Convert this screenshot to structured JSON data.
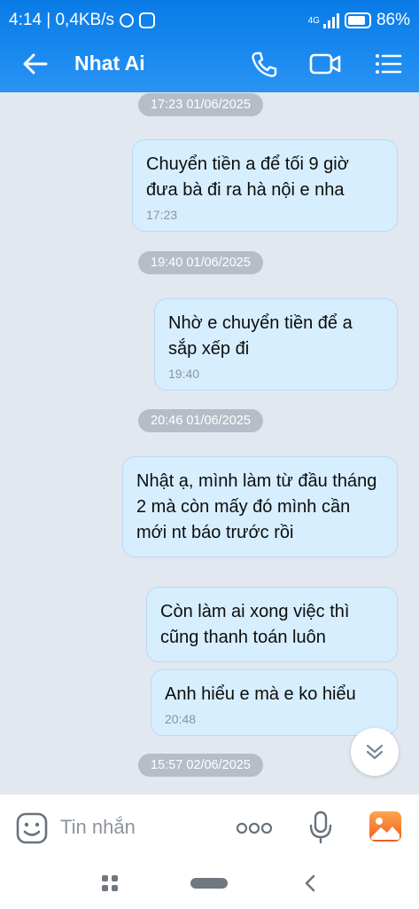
{
  "status_bar": {
    "time": "4:14 | 0,4KB/s",
    "network": "4G",
    "battery": "86%",
    "battery_level": 0.86
  },
  "header": {
    "contact_name": "Nhat Ai",
    "icons": [
      "back-arrow-icon",
      "phone-icon",
      "video-icon",
      "menu-icon"
    ]
  },
  "messages": [
    {
      "type": "timestamp",
      "text": "17:23 01/06/2025"
    },
    {
      "type": "bubble",
      "text": "Chuyển tiền a để tối 9 giờ đưa bà đi ra hà nội e nha",
      "time": "17:23"
    },
    {
      "type": "timestamp",
      "text": "19:40 01/06/2025"
    },
    {
      "type": "bubble",
      "text": "Nhờ e chuyển tiền để a sắp xếp đi",
      "time": "19:40"
    },
    {
      "type": "timestamp",
      "text": "20:46 01/06/2025"
    },
    {
      "type": "bubble",
      "text": "Nhật ạ, mình làm từ đầu tháng 2 mà còn mấy đó mình cần mới nt báo trước rồi",
      "time": ""
    },
    {
      "type": "bubble",
      "text": "Còn làm ai xong việc thì cũng thanh toán luôn",
      "time": ""
    },
    {
      "type": "bubble",
      "text": "Anh hiểu e mà e ko hiểu",
      "time": "20:48"
    },
    {
      "type": "timestamp",
      "text": "15:57 02/06/2025"
    }
  ],
  "input": {
    "placeholder": "Tin nhắn",
    "icons": [
      "sticker-icon",
      "more-dots-icon",
      "microphone-icon",
      "gallery-icon"
    ]
  },
  "colors": {
    "header": "#1a8af0",
    "bubble": "#d7eefe",
    "background": "#e2e8f0",
    "timestamp_pill": "#b6bdc6"
  }
}
